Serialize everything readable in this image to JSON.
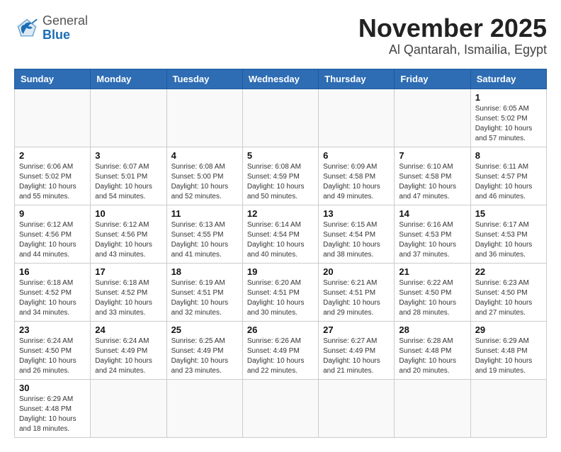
{
  "header": {
    "logo_general": "General",
    "logo_blue": "Blue",
    "month": "November 2025",
    "location": "Al Qantarah, Ismailia, Egypt"
  },
  "weekdays": [
    "Sunday",
    "Monday",
    "Tuesday",
    "Wednesday",
    "Thursday",
    "Friday",
    "Saturday"
  ],
  "days": [
    {
      "num": "",
      "info": ""
    },
    {
      "num": "",
      "info": ""
    },
    {
      "num": "",
      "info": ""
    },
    {
      "num": "",
      "info": ""
    },
    {
      "num": "",
      "info": ""
    },
    {
      "num": "",
      "info": ""
    },
    {
      "num": "1",
      "info": "Sunrise: 6:05 AM\nSunset: 5:02 PM\nDaylight: 10 hours\nand 57 minutes."
    },
    {
      "num": "2",
      "info": "Sunrise: 6:06 AM\nSunset: 5:02 PM\nDaylight: 10 hours\nand 55 minutes."
    },
    {
      "num": "3",
      "info": "Sunrise: 6:07 AM\nSunset: 5:01 PM\nDaylight: 10 hours\nand 54 minutes."
    },
    {
      "num": "4",
      "info": "Sunrise: 6:08 AM\nSunset: 5:00 PM\nDaylight: 10 hours\nand 52 minutes."
    },
    {
      "num": "5",
      "info": "Sunrise: 6:08 AM\nSunset: 4:59 PM\nDaylight: 10 hours\nand 50 minutes."
    },
    {
      "num": "6",
      "info": "Sunrise: 6:09 AM\nSunset: 4:58 PM\nDaylight: 10 hours\nand 49 minutes."
    },
    {
      "num": "7",
      "info": "Sunrise: 6:10 AM\nSunset: 4:58 PM\nDaylight: 10 hours\nand 47 minutes."
    },
    {
      "num": "8",
      "info": "Sunrise: 6:11 AM\nSunset: 4:57 PM\nDaylight: 10 hours\nand 46 minutes."
    },
    {
      "num": "9",
      "info": "Sunrise: 6:12 AM\nSunset: 4:56 PM\nDaylight: 10 hours\nand 44 minutes."
    },
    {
      "num": "10",
      "info": "Sunrise: 6:12 AM\nSunset: 4:56 PM\nDaylight: 10 hours\nand 43 minutes."
    },
    {
      "num": "11",
      "info": "Sunrise: 6:13 AM\nSunset: 4:55 PM\nDaylight: 10 hours\nand 41 minutes."
    },
    {
      "num": "12",
      "info": "Sunrise: 6:14 AM\nSunset: 4:54 PM\nDaylight: 10 hours\nand 40 minutes."
    },
    {
      "num": "13",
      "info": "Sunrise: 6:15 AM\nSunset: 4:54 PM\nDaylight: 10 hours\nand 38 minutes."
    },
    {
      "num": "14",
      "info": "Sunrise: 6:16 AM\nSunset: 4:53 PM\nDaylight: 10 hours\nand 37 minutes."
    },
    {
      "num": "15",
      "info": "Sunrise: 6:17 AM\nSunset: 4:53 PM\nDaylight: 10 hours\nand 36 minutes."
    },
    {
      "num": "16",
      "info": "Sunrise: 6:18 AM\nSunset: 4:52 PM\nDaylight: 10 hours\nand 34 minutes."
    },
    {
      "num": "17",
      "info": "Sunrise: 6:18 AM\nSunset: 4:52 PM\nDaylight: 10 hours\nand 33 minutes."
    },
    {
      "num": "18",
      "info": "Sunrise: 6:19 AM\nSunset: 4:51 PM\nDaylight: 10 hours\nand 32 minutes."
    },
    {
      "num": "19",
      "info": "Sunrise: 6:20 AM\nSunset: 4:51 PM\nDaylight: 10 hours\nand 30 minutes."
    },
    {
      "num": "20",
      "info": "Sunrise: 6:21 AM\nSunset: 4:51 PM\nDaylight: 10 hours\nand 29 minutes."
    },
    {
      "num": "21",
      "info": "Sunrise: 6:22 AM\nSunset: 4:50 PM\nDaylight: 10 hours\nand 28 minutes."
    },
    {
      "num": "22",
      "info": "Sunrise: 6:23 AM\nSunset: 4:50 PM\nDaylight: 10 hours\nand 27 minutes."
    },
    {
      "num": "23",
      "info": "Sunrise: 6:24 AM\nSunset: 4:50 PM\nDaylight: 10 hours\nand 26 minutes."
    },
    {
      "num": "24",
      "info": "Sunrise: 6:24 AM\nSunset: 4:49 PM\nDaylight: 10 hours\nand 24 minutes."
    },
    {
      "num": "25",
      "info": "Sunrise: 6:25 AM\nSunset: 4:49 PM\nDaylight: 10 hours\nand 23 minutes."
    },
    {
      "num": "26",
      "info": "Sunrise: 6:26 AM\nSunset: 4:49 PM\nDaylight: 10 hours\nand 22 minutes."
    },
    {
      "num": "27",
      "info": "Sunrise: 6:27 AM\nSunset: 4:49 PM\nDaylight: 10 hours\nand 21 minutes."
    },
    {
      "num": "28",
      "info": "Sunrise: 6:28 AM\nSunset: 4:48 PM\nDaylight: 10 hours\nand 20 minutes."
    },
    {
      "num": "29",
      "info": "Sunrise: 6:29 AM\nSunset: 4:48 PM\nDaylight: 10 hours\nand 19 minutes."
    },
    {
      "num": "30",
      "info": "Sunrise: 6:29 AM\nSunset: 4:48 PM\nDaylight: 10 hours\nand 18 minutes."
    },
    {
      "num": "",
      "info": ""
    },
    {
      "num": "",
      "info": ""
    },
    {
      "num": "",
      "info": ""
    },
    {
      "num": "",
      "info": ""
    },
    {
      "num": "",
      "info": ""
    },
    {
      "num": "",
      "info": ""
    }
  ]
}
